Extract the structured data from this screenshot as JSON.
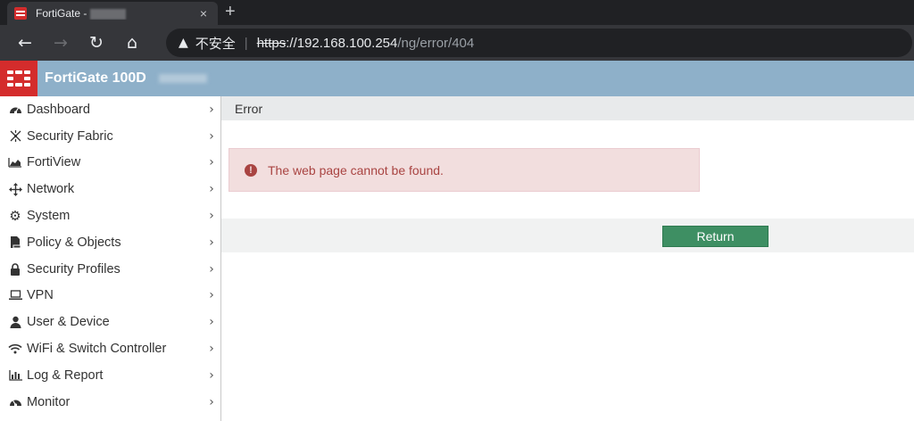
{
  "browser": {
    "tab_title": "FortiGate -",
    "tab_close": "×",
    "new_tab": "+",
    "insecure_label": "不安全",
    "separator": "|",
    "url_scheme": "https",
    "url_host": "://192.168.100.254",
    "url_path": "/ng/error/404"
  },
  "app": {
    "title": "FortiGate 100D",
    "logo_color": "#d42c2c",
    "header_color": "#8eb0c9"
  },
  "sidebar": {
    "items": [
      {
        "label": "Dashboard",
        "icon": "dashboard-icon"
      },
      {
        "label": "Security Fabric",
        "icon": "security-fabric-icon"
      },
      {
        "label": "FortiView",
        "icon": "fortiview-chart-icon"
      },
      {
        "label": "Network",
        "icon": "network-arrows-icon"
      },
      {
        "label": "System",
        "icon": "gear-icon"
      },
      {
        "label": "Policy & Objects",
        "icon": "policy-document-icon"
      },
      {
        "label": "Security Profiles",
        "icon": "lock-icon"
      },
      {
        "label": "VPN",
        "icon": "laptop-icon"
      },
      {
        "label": "User & Device",
        "icon": "user-icon"
      },
      {
        "label": "WiFi & Switch Controller",
        "icon": "wifi-icon"
      },
      {
        "label": "Log & Report",
        "icon": "bar-chart-icon"
      },
      {
        "label": "Monitor",
        "icon": "monitor-gauge-icon"
      }
    ]
  },
  "main": {
    "header": "Error",
    "alert_message": "The web page cannot be found.",
    "alert_icon": "exclamation-circle-icon",
    "return_label": "Return",
    "return_color": "#3e8f63"
  }
}
